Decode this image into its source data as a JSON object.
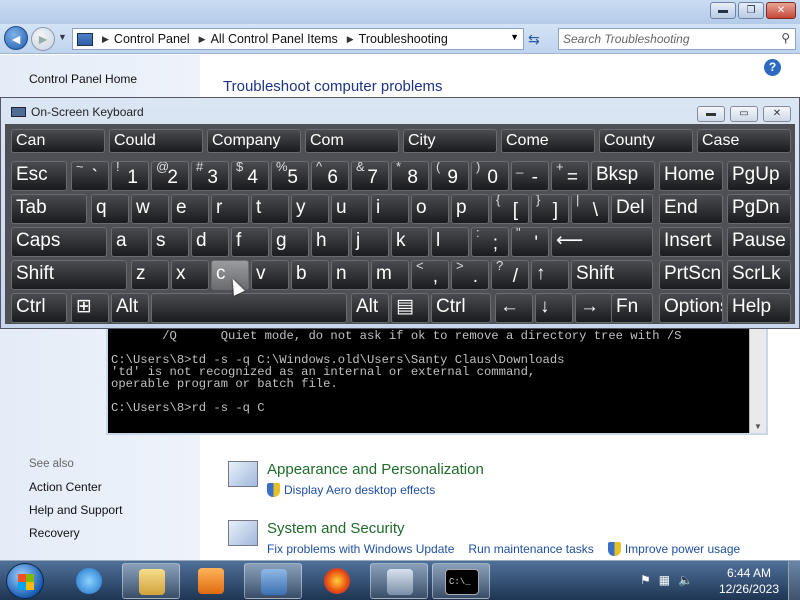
{
  "window": {
    "minimize": "▬",
    "maximize": "❐",
    "close": "✕"
  },
  "nav": {
    "back": "◄",
    "forward": "►",
    "breadcrumbs": [
      "Control Panel",
      "All Control Panel Items",
      "Troubleshooting"
    ],
    "search_placeholder": "Search Troubleshooting"
  },
  "sidebar": {
    "home": "Control Panel Home",
    "see_also_label": "See also",
    "see_also": [
      "Action Center",
      "Help and Support",
      "Recovery"
    ]
  },
  "main": {
    "title": "Troubleshoot computer problems",
    "sections": [
      {
        "title": "Appearance and Personalization",
        "links": [
          "Display Aero desktop effects"
        ]
      },
      {
        "title": "System and Security",
        "links": [
          "Fix problems with Windows Update",
          "Run maintenance tasks",
          "Improve power usage"
        ]
      }
    ]
  },
  "console": {
    "lines": [
      "       /Q      Quiet mode, do not ask if ok to remove a directory tree with /S",
      "",
      "C:\\Users\\8>td -s -q C:\\Windows.old\\Users\\Santy Claus\\Downloads",
      "'td' is not recognized as an internal or external command,",
      "operable program or batch file.",
      "",
      "C:\\Users\\8>rd -s -q C"
    ]
  },
  "osk": {
    "title": "On-Screen Keyboard",
    "predictions": [
      "Can",
      "Could",
      "Company",
      "Com",
      "City",
      "Come",
      "County",
      "Case"
    ],
    "row1": [
      {
        "main": "Esc"
      },
      {
        "sh": "~",
        "mn": "`"
      },
      {
        "sh": "!",
        "mn": "1"
      },
      {
        "sh": "@",
        "mn": "2"
      },
      {
        "sh": "#",
        "mn": "3"
      },
      {
        "sh": "$",
        "mn": "4"
      },
      {
        "sh": "%",
        "mn": "5"
      },
      {
        "sh": "^",
        "mn": "6"
      },
      {
        "sh": "&",
        "mn": "7"
      },
      {
        "sh": "*",
        "mn": "8"
      },
      {
        "sh": "(",
        "mn": "9"
      },
      {
        "sh": ")",
        "mn": "0"
      },
      {
        "sh": "_",
        "mn": "-"
      },
      {
        "sh": "+",
        "mn": "="
      },
      {
        "main": "Bksp"
      },
      {
        "main": "Home"
      },
      {
        "main": "PgUp"
      }
    ],
    "row2": [
      "Tab",
      "q",
      "w",
      "e",
      "r",
      "t",
      "y",
      "u",
      "i",
      "o",
      "p",
      "{[",
      "}]",
      "|\\",
      "Del",
      "End",
      "PgDn"
    ],
    "row3": [
      "Caps",
      "a",
      "s",
      "d",
      "f",
      "g",
      "h",
      "j",
      "k",
      "l",
      ":;",
      "\"'",
      "⟵",
      "Insert",
      "Pause"
    ],
    "row4": [
      "Shift",
      "z",
      "x",
      "c",
      "v",
      "b",
      "n",
      "m",
      "<,",
      ">.",
      "?/",
      "↑",
      "Shift",
      "PrtScn",
      "ScrLk"
    ],
    "row5": [
      "Ctrl",
      "⊞",
      "Alt",
      "",
      "Alt",
      "▤",
      "Ctrl",
      "←",
      "↓",
      "→",
      "Fn",
      "Options",
      "Help"
    ]
  },
  "taskbar": {
    "time": "6:44 AM",
    "date": "12/26/2023",
    "console_label": "C:\\_"
  },
  "colors": {
    "section_title": "#1f6c2a",
    "page_title": "#1e3287",
    "link": "#1f4f9e"
  }
}
